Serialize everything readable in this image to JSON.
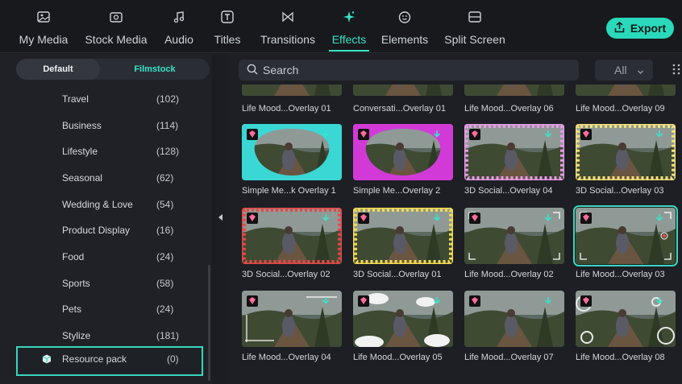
{
  "toolbar": {
    "tabs": [
      {
        "label": "My Media",
        "icon": "media-icon"
      },
      {
        "label": "Stock Media",
        "icon": "stock-media-icon"
      },
      {
        "label": "Audio",
        "icon": "music-note-icon"
      },
      {
        "label": "Titles",
        "icon": "titles-icon"
      },
      {
        "label": "Transitions",
        "icon": "transitions-icon"
      },
      {
        "label": "Effects",
        "icon": "sparkle-icon",
        "active": true
      },
      {
        "label": "Elements",
        "icon": "smiley-icon"
      },
      {
        "label": "Split Screen",
        "icon": "split-screen-icon"
      }
    ],
    "export_label": "Export"
  },
  "sidebar": {
    "segments": {
      "default": "Default",
      "filmstock": "Filmstock"
    },
    "categories": [
      {
        "name": "Travel",
        "count": "(102)"
      },
      {
        "name": "Business",
        "count": "(114)"
      },
      {
        "name": "Lifestyle",
        "count": "(128)"
      },
      {
        "name": "Seasonal",
        "count": "(62)"
      },
      {
        "name": "Wedding & Love",
        "count": "(54)"
      },
      {
        "name": "Product Display",
        "count": "(16)"
      },
      {
        "name": "Food",
        "count": "(24)"
      },
      {
        "name": "Sports",
        "count": "(58)"
      },
      {
        "name": "Pets",
        "count": "(24)"
      },
      {
        "name": "Stylize",
        "count": "(181)"
      },
      {
        "name": "Resource pack",
        "count": "(0)",
        "selected": true
      }
    ]
  },
  "main": {
    "search_placeholder": "Search",
    "filter_value": "All",
    "captions_row0": [
      "Life Mood...Overlay 01",
      "Conversati...Overlay 01",
      "Life Mood...Overlay 06",
      "Life Mood...Overlay 09"
    ],
    "items": [
      {
        "caption": "Simple Me...k Overlay 1",
        "frame": "cyan"
      },
      {
        "caption": "Simple Me...Overlay 2",
        "frame": "magenta"
      },
      {
        "caption": "3D Social...Overlay 04",
        "frame": "pink-dots"
      },
      {
        "caption": "3D Social...Overlay 03",
        "frame": "yellow-dots"
      },
      {
        "caption": "3D Social...Overlay 02",
        "frame": "red-hearts"
      },
      {
        "caption": "3D Social...Overlay 01",
        "frame": "yellow-smiles"
      },
      {
        "caption": "Life Mood...Overlay 02",
        "frame": "corners"
      },
      {
        "caption": "Life Mood...Overlay 03",
        "frame": "rec",
        "selected": true
      },
      {
        "caption": "Life Mood...Overlay 04",
        "frame": "lines"
      },
      {
        "caption": "Life Mood...Overlay 05",
        "frame": "clouds"
      },
      {
        "caption": "Life Mood...Overlay 07",
        "frame": "plain"
      },
      {
        "caption": "Life Mood...Overlay 08",
        "frame": "bubbles"
      }
    ]
  },
  "colors": {
    "accent": "#39e3c8",
    "export": "#2ad9bb",
    "badge": "#ff6b9a"
  }
}
